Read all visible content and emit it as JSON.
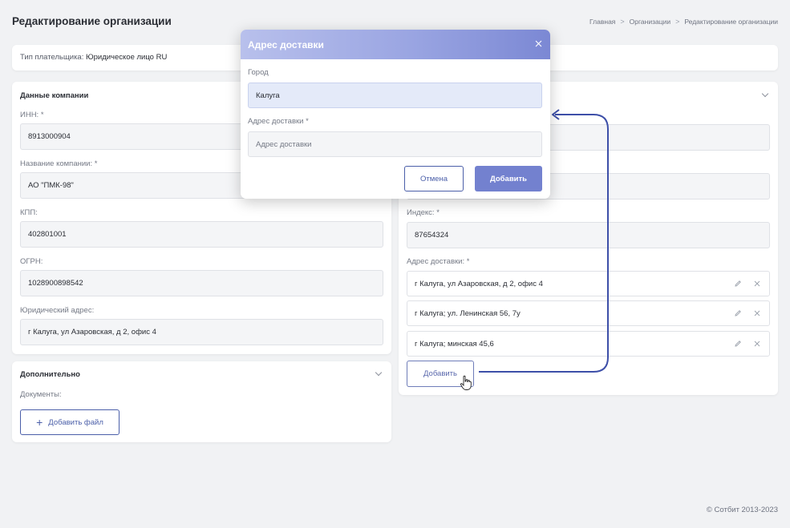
{
  "page": {
    "title": "Редактирование организации",
    "breadcrumb": [
      "Главная",
      "Организации",
      "Редактирование организации"
    ],
    "footer": "© Сотбит 2013-2023"
  },
  "payer": {
    "label": "Тип плательщика:",
    "value": "Юридическое лицо RU"
  },
  "company": {
    "title": "Данные компании",
    "fields": [
      {
        "label": "ИНН:",
        "required": true,
        "value": "8913000904"
      },
      {
        "label": "Название компании:",
        "required": true,
        "value": "АО \"ПМК-98\""
      },
      {
        "label": "КПП:",
        "required": false,
        "value": "402801001"
      },
      {
        "label": "ОГРН:",
        "required": false,
        "value": "1028900898542"
      },
      {
        "label": "Юридический адрес:",
        "required": false,
        "value": "г Калуга, ул Азаровская, д 2, офис 4"
      }
    ]
  },
  "extra": {
    "title": "Дополнительно",
    "documents_label": "Документы:",
    "add_file_label": "Добавить файл"
  },
  "delivery": {
    "index_label": "Индекс:",
    "index_value": "87654324",
    "address_label": "Адрес доставки:",
    "addresses": [
      "г Калуга, ул Азаровская, д 2, офис 4",
      "г Калуга; ул. Ленинская 56, 7у",
      "г Калуга; минская 45,6"
    ],
    "add_label": "Добавить"
  },
  "modal": {
    "title": "Адрес доставки",
    "city_label": "Город",
    "city_value": "Калуга",
    "address_label": "Адрес доставки",
    "address_placeholder": "Адрес доставки",
    "cancel_label": "Отмена",
    "submit_label": "Добавить"
  },
  "required_mark": "*",
  "colors": {
    "accent": "#4b5fa9",
    "primary_button": "#7381cf",
    "arrow": "#3d4fa8"
  }
}
